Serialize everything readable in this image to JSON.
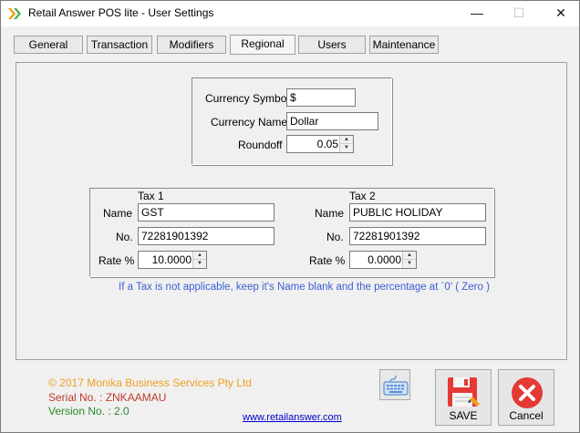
{
  "window": {
    "title": "Retail Answer POS lite - User Settings",
    "controls": {
      "minimize": "—",
      "maximize": "☐",
      "close": "✕"
    }
  },
  "tabs": [
    {
      "label": "General",
      "active": false
    },
    {
      "label": "Transaction",
      "active": false
    },
    {
      "label": "Modifiers",
      "active": false
    },
    {
      "label": "Regional",
      "active": true
    },
    {
      "label": "Users",
      "active": false
    },
    {
      "label": "Maintenance",
      "active": false
    }
  ],
  "currency": {
    "symbol_label": "Currency Symbol",
    "symbol_value": "$",
    "name_label": "Currency Name",
    "name_value": "Dollar",
    "roundoff_label": "Roundoff",
    "roundoff_value": "0.05"
  },
  "tax1": {
    "heading": "Tax 1",
    "name_label": "Name",
    "name_value": "GST",
    "no_label": "No.",
    "no_value": "72281901392",
    "rate_label": "Rate %",
    "rate_value": "10.0000"
  },
  "tax2": {
    "heading": "Tax 2",
    "name_label": "Name",
    "name_value": "PUBLIC HOLIDAY",
    "no_label": "No.",
    "no_value": "72281901392",
    "rate_label": "Rate %",
    "rate_value": "0.0000"
  },
  "info_text": "If a Tax is not applicable, keep it's Name blank and the percentage at `0' ( Zero )",
  "footer": {
    "copyright": "© 2017 Monika Business Services Pty Ltd",
    "serial": "Serial No. : ZNKAAMAU",
    "version": "Version No. : 2.0",
    "website": "www.retailanswer.com"
  },
  "buttons": {
    "save": "SAVE",
    "cancel": "Cancel"
  },
  "colors": {
    "info_text": "#3b5fd4",
    "copyright": "#f0a020",
    "serial": "#c0392b",
    "version": "#2c8a2c",
    "cancel_icon": "#e53935",
    "save_icon": "#e53935"
  },
  "icons": {
    "app": "double-chevron-icon",
    "keyboard": "keyboard-icon",
    "save": "floppy-disk-icon",
    "cancel": "close-circle-icon"
  }
}
